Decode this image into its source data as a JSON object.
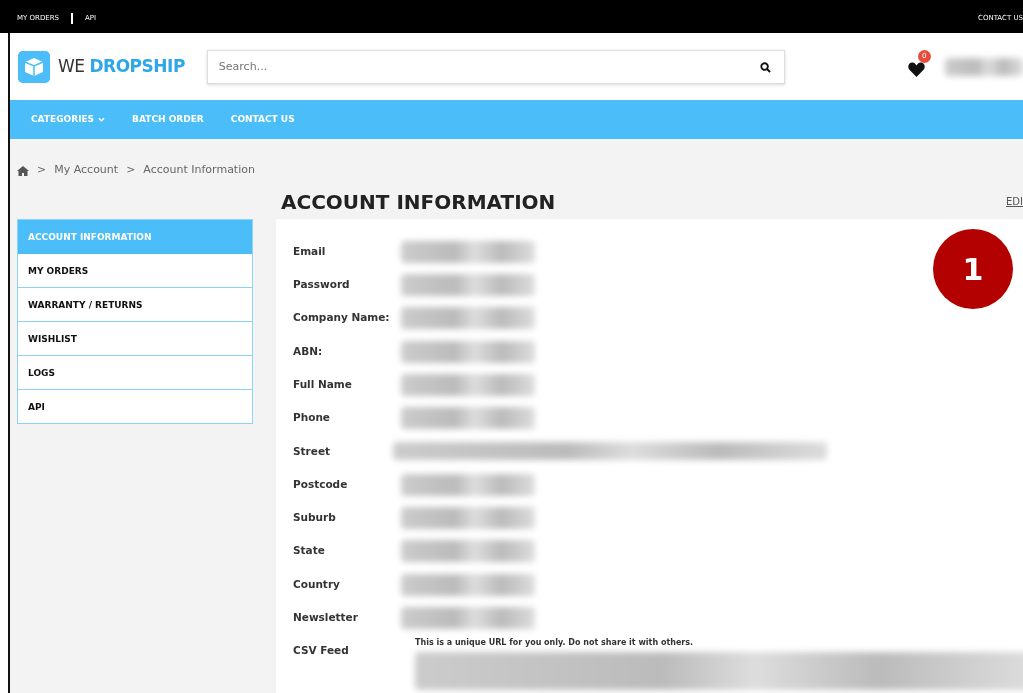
{
  "top_bar": {
    "left_links": [
      "MY ORDERS",
      "API"
    ],
    "right_link": "CONTACT US"
  },
  "header": {
    "logo": {
      "light": "WE",
      "bold": "DROPSHIP"
    },
    "search": {
      "placeholder": "Search..."
    },
    "wishlist_count": "0"
  },
  "nav": [
    {
      "label": "CATEGORIES",
      "dropdown": true
    },
    {
      "label": "BATCH ORDER",
      "dropdown": false
    },
    {
      "label": "CONTACT US",
      "dropdown": false
    }
  ],
  "breadcrumb": {
    "separator": ">",
    "items": [
      "My Account",
      "Account Information"
    ]
  },
  "page_title": "ACCOUNT INFORMATION",
  "edit_link": "EDI",
  "sidebar": {
    "items": [
      {
        "label": "ACCOUNT INFORMATION",
        "selected": true
      },
      {
        "label": "MY ORDERS",
        "selected": false
      },
      {
        "label": "WARRANTY / RETURNS",
        "selected": false
      },
      {
        "label": "WISHLIST",
        "selected": false
      },
      {
        "label": "LOGS",
        "selected": false
      },
      {
        "label": "API",
        "selected": false
      }
    ]
  },
  "fields": [
    {
      "label": "Email",
      "kind": "short"
    },
    {
      "label": "Password",
      "kind": "short"
    },
    {
      "label": "Company Name:",
      "kind": "short"
    },
    {
      "label": "ABN:",
      "kind": "short"
    },
    {
      "label": "Full Name",
      "kind": "short"
    },
    {
      "label": "Phone",
      "kind": "short"
    },
    {
      "label": "Street",
      "kind": "long"
    },
    {
      "label": "Postcode",
      "kind": "short"
    },
    {
      "label": "Suburb",
      "kind": "short"
    },
    {
      "label": "State",
      "kind": "short"
    },
    {
      "label": "Country",
      "kind": "short"
    },
    {
      "label": "Newsletter",
      "kind": "short"
    },
    {
      "label": "CSV Feed",
      "kind": "feed",
      "note": "This is a unique URL for you only. Do not share it with others."
    }
  ],
  "annotation": "1"
}
